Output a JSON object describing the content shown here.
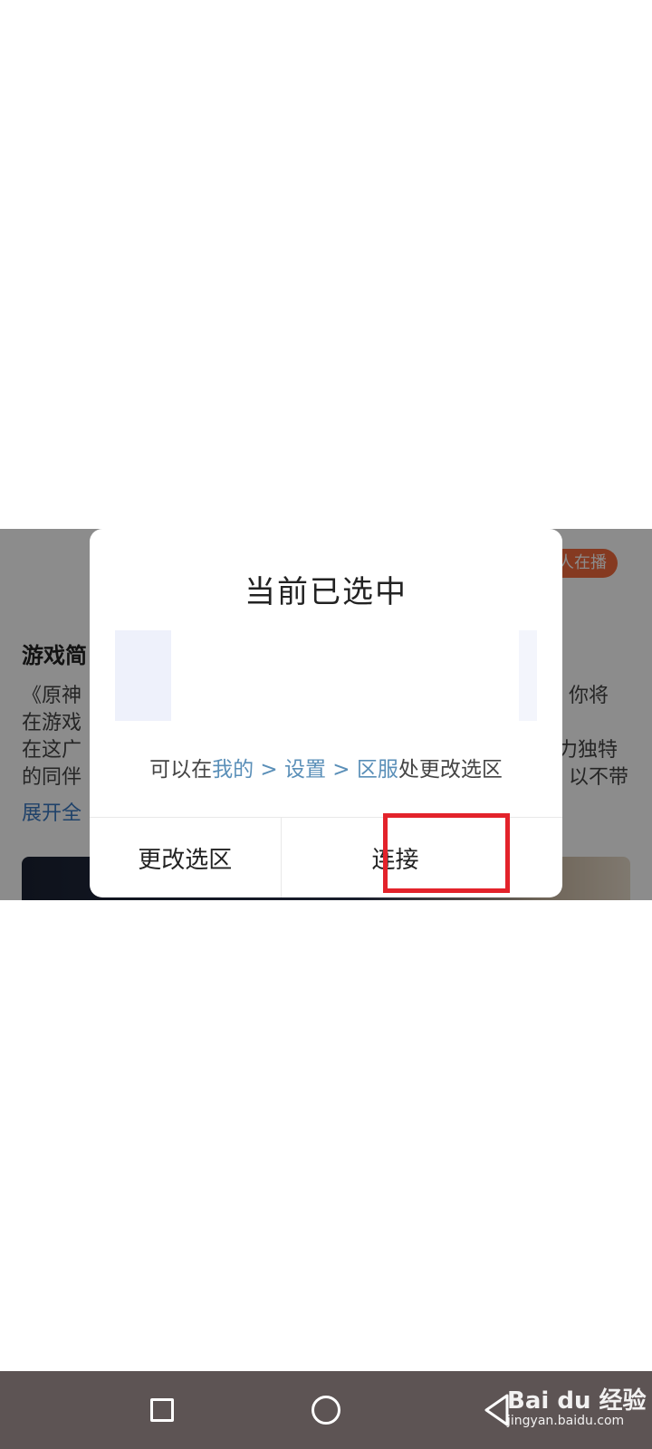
{
  "background_app": {
    "live_badge": "人在播",
    "section_title": "游戏简",
    "description_lines": [
      "《原神",
      "在游戏",
      "在这广",
      "的同伴"
    ],
    "description_right": [
      "你将",
      "",
      "力独特",
      "以不带"
    ],
    "expand_link": "展开全"
  },
  "dialog": {
    "title": "当前已选中",
    "hint_prefix": "可以在",
    "hint_link_1": "我的",
    "hint_sep_1": " > ",
    "hint_link_2": "设置",
    "hint_sep_2": " > ",
    "hint_link_3": "区服",
    "hint_suffix": "处更改选区",
    "change_button": "更改选区",
    "connect_button": "连接"
  },
  "nav_bar": {
    "icons": [
      "recent-apps-icon",
      "home-icon",
      "back-icon"
    ]
  },
  "watermark": {
    "main": "Bai du 经验",
    "sub": "jingyan.baidu.com"
  },
  "colors": {
    "highlight": "#e3232b",
    "link": "#5a8fb8",
    "nav_bar": "#5d5454"
  }
}
